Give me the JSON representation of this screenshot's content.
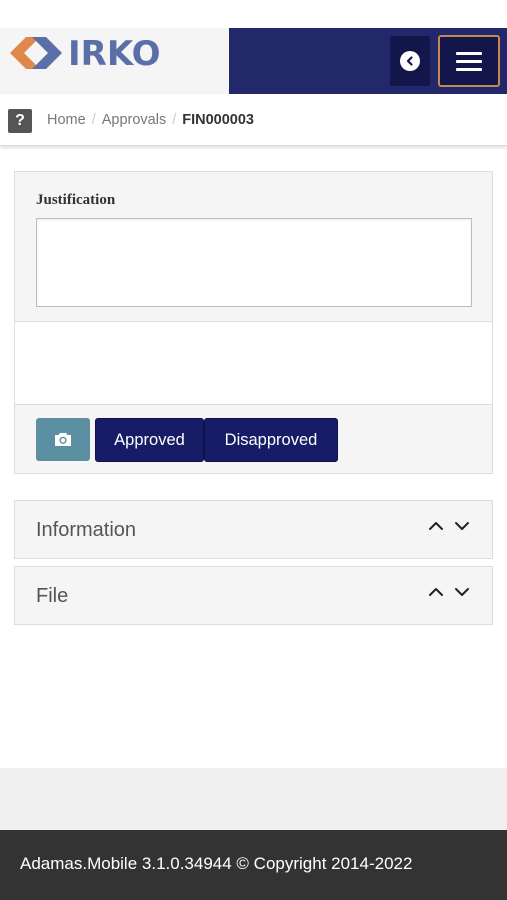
{
  "header": {
    "logo_text": "IRKO",
    "brand_colors": {
      "logo_orange": "#e0874a",
      "logo_blue": "#5a6ea8",
      "nav_bg": "#23286b",
      "menu_border": "#c7884f"
    },
    "back_icon": "chevron-left-circle-icon",
    "menu_icon": "hamburger-menu-icon"
  },
  "breadcrumb": {
    "help_icon_label": "?",
    "items": [
      "Home",
      "Approvals",
      "FIN000003"
    ]
  },
  "form": {
    "justification_label": "Justification",
    "justification_value": "",
    "camera_icon": "camera-icon",
    "approved_label": "Approved",
    "disapproved_label": "Disapproved",
    "accent_button_color": "#171c66",
    "camera_button_color": "#5b8fa1"
  },
  "sections": [
    {
      "title": "Information"
    },
    {
      "title": "File"
    }
  ],
  "footer": {
    "text": "Adamas.Mobile 3.1.0.34944 © Copyright 2014-2022"
  }
}
